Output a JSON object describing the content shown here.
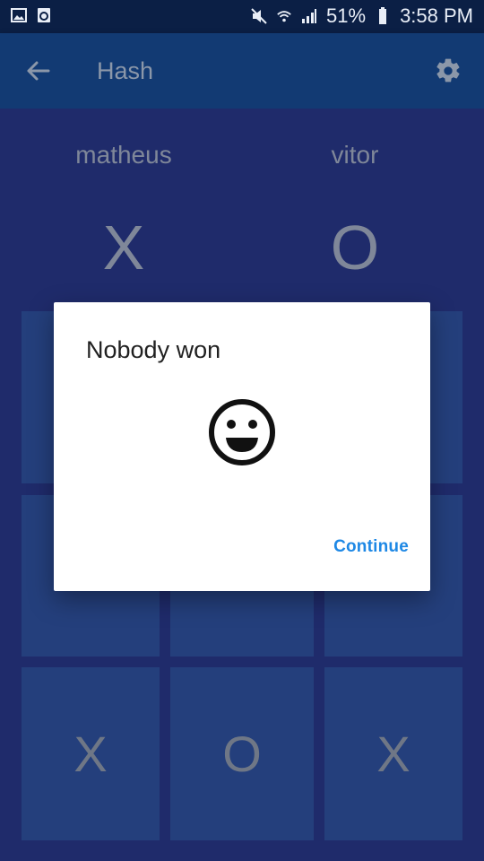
{
  "status_bar": {
    "battery": "51%",
    "time": "3:58 PM",
    "icons": [
      "image-icon",
      "recycle-icon",
      "mute-icon",
      "wifi-icon",
      "signal-icon",
      "battery-icon"
    ]
  },
  "app_bar": {
    "title": "Hash",
    "icons": [
      "back-arrow-icon",
      "gear-icon"
    ]
  },
  "players": [
    {
      "name": "matheus",
      "mark": "X"
    },
    {
      "name": "vitor",
      "mark": "O"
    }
  ],
  "board": {
    "cells": [
      "",
      "",
      "",
      "",
      "",
      "",
      "X",
      "O",
      "X"
    ]
  },
  "dialog": {
    "title": "Nobody won",
    "icon": "smiley-icon",
    "continue_label": "Continue"
  },
  "colors": {
    "status_bar": "#0b1f45",
    "app_bar": "#123a73",
    "background": "#1f2b6b",
    "cell": "#243f7c",
    "accent": "#1e88e5"
  }
}
